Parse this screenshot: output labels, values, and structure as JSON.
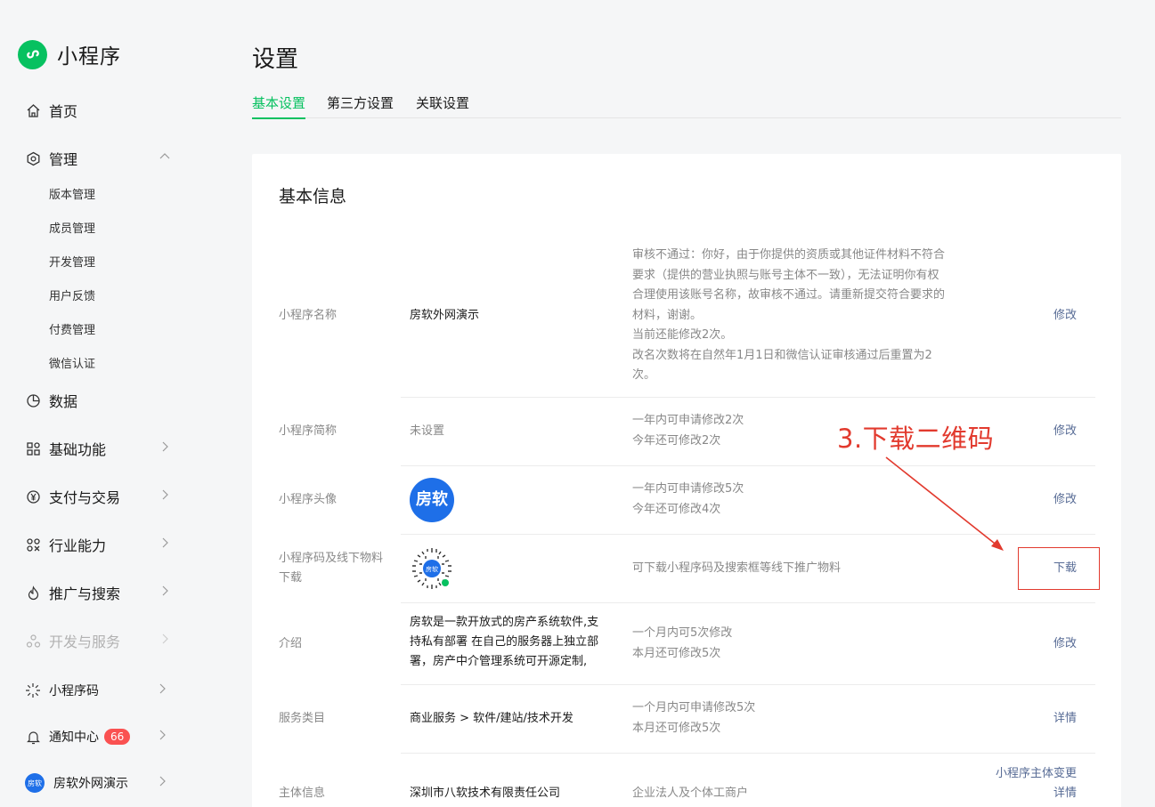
{
  "app": {
    "title": "小程序"
  },
  "sidebar": {
    "home": "首页",
    "manage": "管理",
    "manage_items": [
      "版本管理",
      "成员管理",
      "开发管理",
      "用户反馈",
      "付费管理",
      "微信认证"
    ],
    "data": "数据",
    "basic": "基础功能",
    "payment": "支付与交易",
    "industry": "行业能力",
    "promo": "推广与搜索",
    "devservice": "开发与服务",
    "qrcode": "小程序码",
    "notify": "通知中心",
    "notify_count": "66",
    "account": "房软外网演示",
    "account_avatar": "房软"
  },
  "page": {
    "title": "设置",
    "tabs": [
      "基本设置",
      "第三方设置",
      "关联设置"
    ]
  },
  "card": {
    "title": "基本信息",
    "rows": [
      {
        "label": "小程序名称",
        "value": "房软外网演示",
        "desc": [
          "审核不通过：你好，由于你提供的资质或其他证件材料不符合",
          "要求（提供的营业执照与账号主体不一致），无法证明你有权",
          "合理使用该账号名称，故审核不通过。请重新提交符合要求的",
          "材料，谢谢。",
          "当前还能修改2次。",
          "改名次数将在自然年1月1日和微信认证审核通过后重置为2",
          "次。"
        ],
        "action": "修改"
      },
      {
        "label": "小程序简称",
        "value": "未设置",
        "desc": [
          "一年内可申请修改2次",
          "今年还可修改2次"
        ],
        "action": "修改"
      },
      {
        "label": "小程序头像",
        "avatar_text": "房软",
        "desc": [
          "一年内可申请修改5次",
          "今年还可修改4次"
        ],
        "action": "修改"
      },
      {
        "label": [
          "小程序码及线下物料",
          "下载"
        ],
        "qr_text": "房软",
        "desc": [
          "可下载小程序码及搜索框等线下推广物料"
        ],
        "action": "下载"
      },
      {
        "label": "介绍",
        "value": [
          "房软是一款开放式的房产系统软件,支",
          "持私有部署 在自己的服务器上独立部",
          "署，房产中介管理系统可开源定制,"
        ],
        "desc": [
          "一个月内可5次修改",
          "本月还可修改5次"
        ],
        "action": "修改"
      },
      {
        "label": "服务类目",
        "value": "商业服务 > 软件/建站/技术开发",
        "desc": [
          "一个月内可申请修改5次",
          "本月还可修改5次"
        ],
        "action": "详情"
      },
      {
        "label": "主体信息",
        "value": "深圳市八软技术有限责任公司",
        "desc": [
          "企业法人及个体工商户"
        ],
        "action": [
          "小程序主体变更",
          "详情"
        ]
      }
    ]
  },
  "annotation": {
    "text": "3.下载二维码",
    "color": "#e23a2e"
  },
  "colors": {
    "brand": "#07c160",
    "link": "#576b95",
    "badge": "#fa5151",
    "avatar": "#1e6fe8"
  }
}
